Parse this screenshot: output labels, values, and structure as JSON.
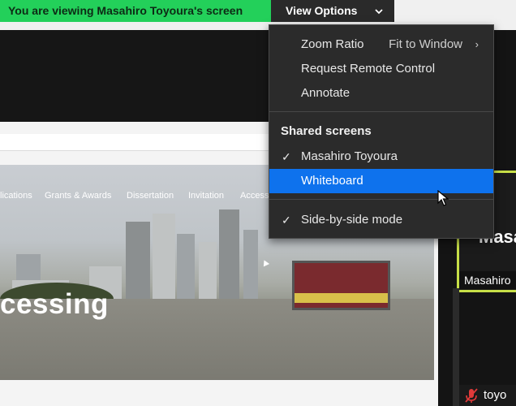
{
  "banner": {
    "text": "You are viewing Masahiro Toyoura's screen",
    "color": "#23d05a"
  },
  "view_options": {
    "label": "View Options",
    "chevron_icon": "chevron-down-icon"
  },
  "menu": {
    "zoom_ratio": {
      "label": "Zoom Ratio",
      "value": "Fit to Window",
      "arrow": "›"
    },
    "request_remote_control": {
      "label": "Request Remote Control"
    },
    "annotate": {
      "label": "Annotate"
    },
    "shared_screens_header": "Shared screens",
    "shared_screens": [
      {
        "label": "Masahiro Toyoura",
        "checked": true,
        "selected": false
      },
      {
        "label": "Whiteboard",
        "checked": false,
        "selected": true
      }
    ],
    "side_by_side": {
      "label": "Side-by-side mode",
      "checked": true
    },
    "check_glyph": "✓",
    "highlight_color": "#0e72ed"
  },
  "shared_page": {
    "nav": [
      "lications",
      "Grants & Awards",
      "Dissertation",
      "Invitation",
      "Access"
    ],
    "title": "cessing",
    "address_hint": "A"
  },
  "participant": {
    "big_name": "Masa",
    "name_label": "Masahiro",
    "bottom_name": "toyo",
    "mic_icon": "microphone-muted-icon",
    "border_color": "#c7df47"
  }
}
